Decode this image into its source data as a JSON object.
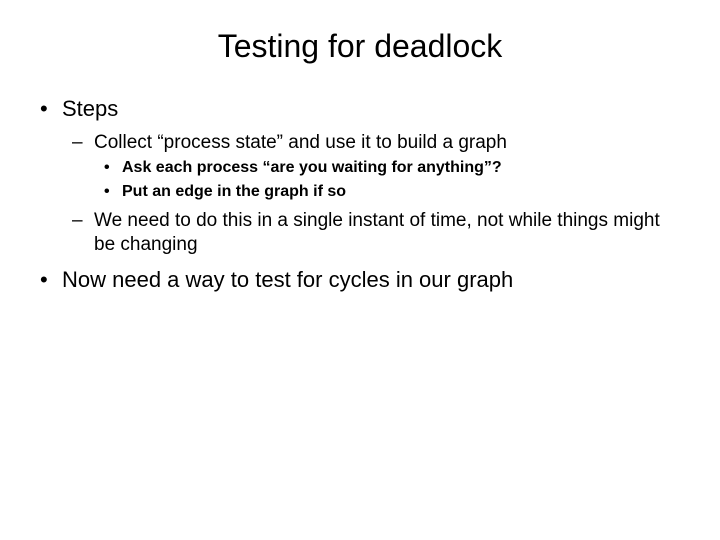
{
  "title": "Testing for deadlock",
  "bullets": {
    "b1": "Steps",
    "b1_1": "Collect “process state” and use it to build a graph",
    "b1_1_1": "Ask each process “are you waiting for anything”?",
    "b1_1_2": "Put an edge in the graph if so",
    "b1_2": "We need to do this in a single instant of time, not while things might be changing",
    "b2": "Now need a way to test for cycles in our graph"
  }
}
